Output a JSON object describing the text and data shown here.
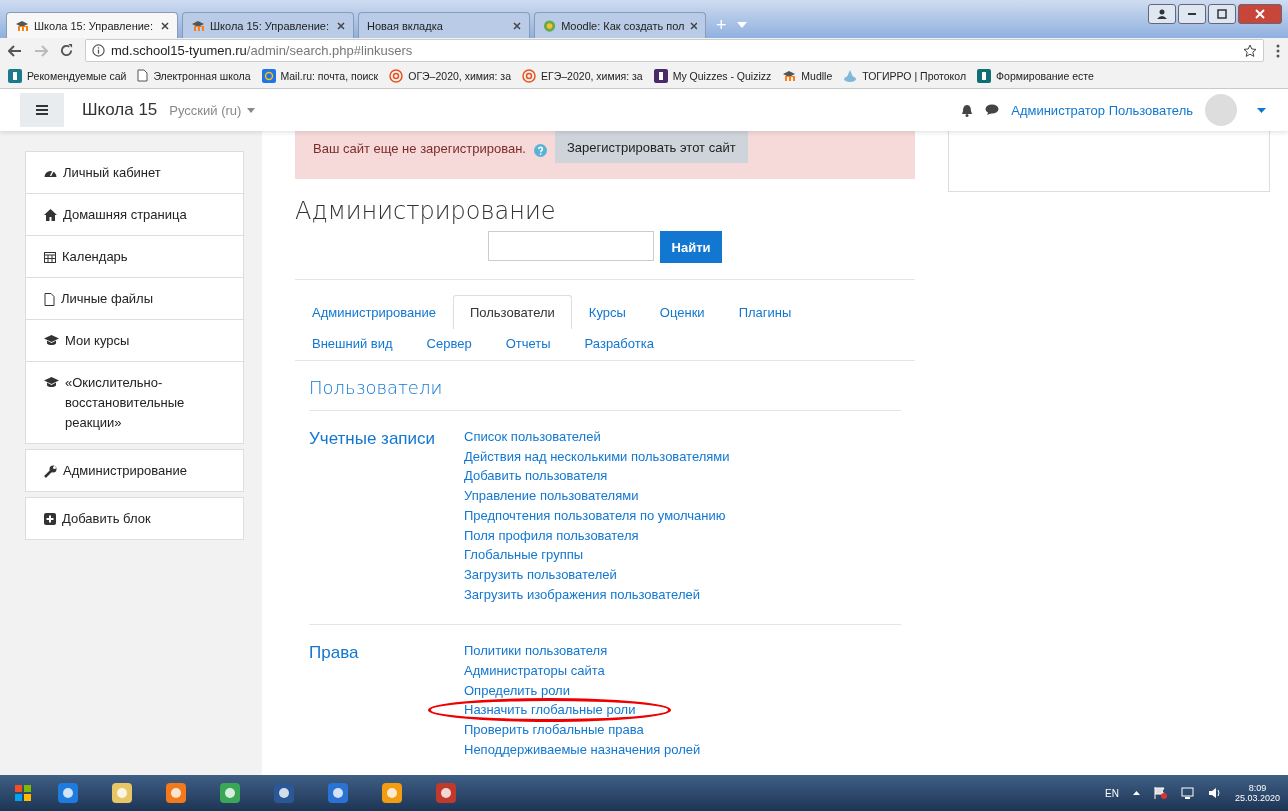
{
  "browser": {
    "tabs": [
      {
        "title": "Школа 15: Управление:",
        "selected": true
      },
      {
        "title": "Школа 15: Управление:",
        "selected": false
      },
      {
        "title": "Новая вкладка",
        "selected": false
      },
      {
        "title": "Moodle: Как создать пол",
        "selected": false
      }
    ],
    "new_tab": "+",
    "address": {
      "host": "md.school15-tyumen.ru",
      "path": "/admin/search.php#linkusers"
    },
    "bookmarks": [
      "Рекомендуемые сай",
      "Электронная школа",
      "Mail.ru: почта, поиск",
      "ОГЭ–2020, химия: за",
      "ЕГЭ–2020, химия: за",
      "My Quizzes - Quizizz",
      "Mudlle",
      "ТОГИРРО | Протокол",
      "Формирование есте"
    ]
  },
  "navbar": {
    "site": "Школа 15",
    "language": "Русский ‎(ru)‎",
    "user": "Администратор Пользователь"
  },
  "sidebar": {
    "items": [
      "Личный кабинет",
      "Домашняя страница",
      "Календарь",
      "Личные файлы",
      "Мои курсы",
      "«Окислительно-восстановительные реакции»"
    ],
    "admin": "Администрирование",
    "add_block": "Добавить блок"
  },
  "alert": {
    "text": "Ваш сайт еще не зарегистрирован.",
    "button": "Зарегистрировать этот сайт"
  },
  "page": {
    "title": "Администрирование",
    "search_button": "Найти",
    "tabs": [
      [
        {
          "label": "Администрирование",
          "selected": false
        },
        {
          "label": "Пользователи",
          "selected": true
        },
        {
          "label": "Курсы",
          "selected": false
        },
        {
          "label": "Оценки",
          "selected": false
        },
        {
          "label": "Плагины",
          "selected": false
        }
      ],
      [
        {
          "label": "Внешний вид",
          "selected": false
        },
        {
          "label": "Сервер",
          "selected": false
        },
        {
          "label": "Отчеты",
          "selected": false
        },
        {
          "label": "Разработка",
          "selected": false
        }
      ]
    ],
    "heading": "Пользователи",
    "sections": [
      {
        "title": "Учетные записи",
        "links": [
          {
            "label": "Список пользователей",
            "highlighted": false
          },
          {
            "label": "Действия над несколькими пользователями",
            "highlighted": false
          },
          {
            "label": "Добавить пользователя",
            "highlighted": false
          },
          {
            "label": "Управление пользователями",
            "highlighted": false
          },
          {
            "label": "Предпочтения пользователя по умолчанию",
            "highlighted": false
          },
          {
            "label": "Поля профиля пользователя",
            "highlighted": false
          },
          {
            "label": "Глобальные группы",
            "highlighted": false
          },
          {
            "label": "Загрузить пользователей",
            "highlighted": false
          },
          {
            "label": "Загрузить изображения пользователей",
            "highlighted": false
          }
        ]
      },
      {
        "title": "Права",
        "links": [
          {
            "label": "Политики пользователя",
            "highlighted": false
          },
          {
            "label": "Администраторы сайта",
            "highlighted": false
          },
          {
            "label": "Определить роли",
            "highlighted": false
          },
          {
            "label": "Назначить глобальные роли",
            "highlighted": true
          },
          {
            "label": "Проверить глобальные права",
            "highlighted": false
          },
          {
            "label": "Неподдерживаемые назначения ролей",
            "highlighted": false
          }
        ]
      }
    ]
  },
  "taskbar": {
    "language": "EN",
    "time": "8:09",
    "date": "25.03.2020"
  }
}
